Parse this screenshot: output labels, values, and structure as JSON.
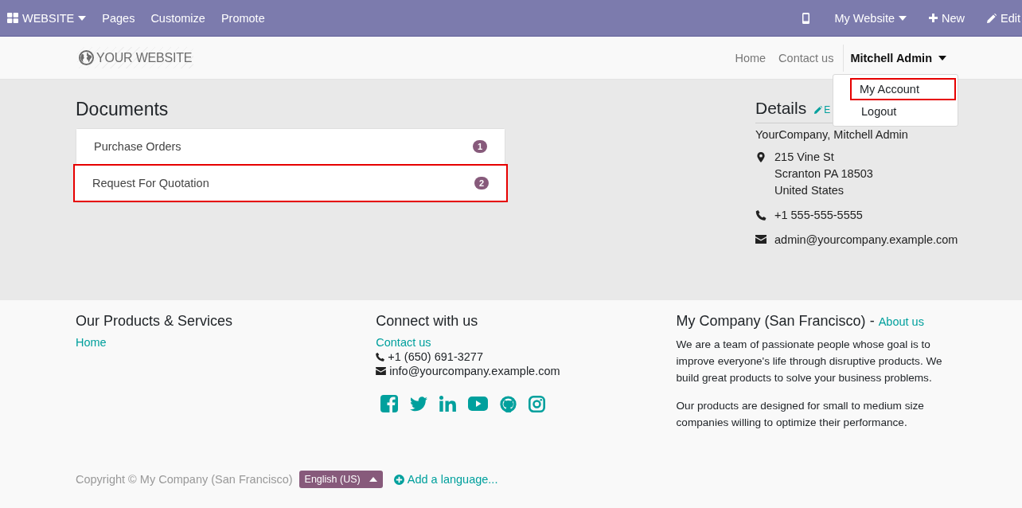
{
  "admin_bar": {
    "app_menu": "WEBSITE",
    "menus": [
      "Pages",
      "Customize",
      "Promote"
    ],
    "website_switcher": "My Website",
    "new": "New",
    "edit": "Edit"
  },
  "header": {
    "logo": "YOUR WEBSITE",
    "nav": [
      "Home",
      "Contact us"
    ],
    "user": "Mitchell Admin",
    "user_menu": [
      {
        "label": "My Account",
        "highlighted": true
      },
      {
        "label": "Logout",
        "highlighted": false
      }
    ]
  },
  "documents": {
    "title": "Documents",
    "items": [
      {
        "label": "Purchase Orders",
        "count": "1",
        "highlighted": false
      },
      {
        "label": "Request For Quotation",
        "count": "2",
        "highlighted": true
      }
    ]
  },
  "details": {
    "title": "Details",
    "edit_link": "E",
    "name": "YourCompany, Mitchell Admin",
    "address": [
      "215 Vine St",
      "Scranton PA 18503",
      "United States"
    ],
    "phone": "+1 555-555-5555",
    "email": "admin@yourcompany.example.com"
  },
  "footer": {
    "products": {
      "title": "Our Products & Services",
      "links": [
        "Home"
      ]
    },
    "connect": {
      "title": "Connect with us",
      "link": "Contact us",
      "phone": "+1 (650) 691-3277",
      "email": "info@yourcompany.example.com",
      "socials": [
        {
          "kind": "facebook"
        },
        {
          "kind": "twitter"
        },
        {
          "kind": "linkedin"
        },
        {
          "kind": "youtube"
        },
        {
          "kind": "github"
        },
        {
          "kind": "instagram"
        }
      ]
    },
    "company": {
      "title": "My Company (San Francisco)",
      "separator": "-",
      "about": "About us",
      "paragraphs": [
        "We are a team of passionate people whose goal is to improve everyone's life through disruptive products. We build great products to solve your business problems.",
        "Our products are designed for small to medium size companies willing to optimize their performance."
      ]
    },
    "copyright": "Copyright © My Company (San Francisco)",
    "language": "English (US)",
    "add_language": "Add a language..."
  }
}
